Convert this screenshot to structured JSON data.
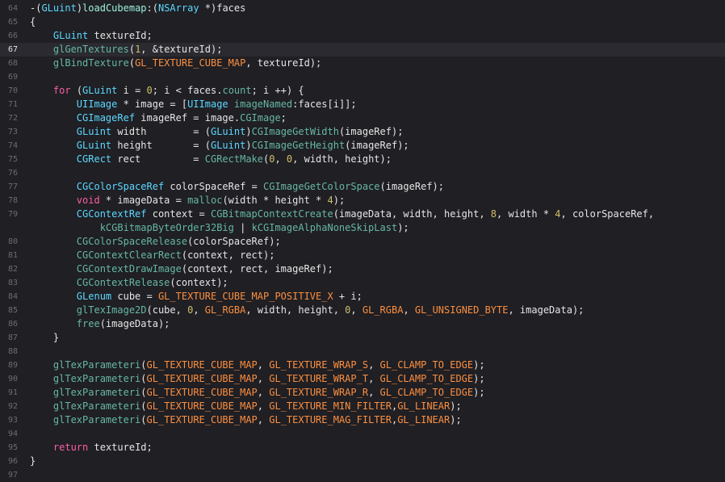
{
  "editor": {
    "current_line_number": "67",
    "lines": [
      {
        "num": "64",
        "current": false,
        "tokens": [
          {
            "t": "-(",
            "c": "plain"
          },
          {
            "t": "GLuint",
            "c": "type"
          },
          {
            "t": ")",
            "c": "plain"
          },
          {
            "t": "loadCubemap",
            "c": "proj"
          },
          {
            "t": ":(",
            "c": "plain"
          },
          {
            "t": "NSArray",
            "c": "type"
          },
          {
            "t": " *)faces",
            "c": "plain"
          }
        ]
      },
      {
        "num": "65",
        "current": false,
        "tokens": [
          {
            "t": "{",
            "c": "plain"
          }
        ]
      },
      {
        "num": "66",
        "current": false,
        "tokens": [
          {
            "t": "    ",
            "c": "plain"
          },
          {
            "t": "GLuint",
            "c": "type"
          },
          {
            "t": " textureId;",
            "c": "plain"
          }
        ]
      },
      {
        "num": "67",
        "current": true,
        "tokens": [
          {
            "t": "    ",
            "c": "plain"
          },
          {
            "t": "glGenTextures",
            "c": "method"
          },
          {
            "t": "(",
            "c": "plain"
          },
          {
            "t": "1",
            "c": "num"
          },
          {
            "t": ", &textureId);",
            "c": "plain"
          }
        ]
      },
      {
        "num": "68",
        "current": false,
        "tokens": [
          {
            "t": "    ",
            "c": "plain"
          },
          {
            "t": "glBindTexture",
            "c": "method"
          },
          {
            "t": "(",
            "c": "plain"
          },
          {
            "t": "GL_TEXTURE_CUBE_MAP",
            "c": "macro"
          },
          {
            "t": ", textureId);",
            "c": "plain"
          }
        ]
      },
      {
        "num": "69",
        "current": false,
        "tokens": [
          {
            "t": "",
            "c": "plain"
          }
        ]
      },
      {
        "num": "70",
        "current": false,
        "tokens": [
          {
            "t": "    ",
            "c": "plain"
          },
          {
            "t": "for",
            "c": "kw"
          },
          {
            "t": " (",
            "c": "plain"
          },
          {
            "t": "GLuint",
            "c": "type"
          },
          {
            "t": " i = ",
            "c": "plain"
          },
          {
            "t": "0",
            "c": "num"
          },
          {
            "t": "; i < faces.",
            "c": "plain"
          },
          {
            "t": "count",
            "c": "method"
          },
          {
            "t": "; i ++) {",
            "c": "plain"
          }
        ]
      },
      {
        "num": "71",
        "current": false,
        "tokens": [
          {
            "t": "        ",
            "c": "plain"
          },
          {
            "t": "UIImage",
            "c": "type"
          },
          {
            "t": " * image = [",
            "c": "plain"
          },
          {
            "t": "UIImage",
            "c": "type"
          },
          {
            "t": " ",
            "c": "plain"
          },
          {
            "t": "imageNamed",
            "c": "method"
          },
          {
            "t": ":faces[i]];",
            "c": "plain"
          }
        ]
      },
      {
        "num": "72",
        "current": false,
        "tokens": [
          {
            "t": "        ",
            "c": "plain"
          },
          {
            "t": "CGImageRef",
            "c": "type"
          },
          {
            "t": " imageRef = image.",
            "c": "plain"
          },
          {
            "t": "CGImage",
            "c": "method"
          },
          {
            "t": ";",
            "c": "plain"
          }
        ]
      },
      {
        "num": "73",
        "current": false,
        "tokens": [
          {
            "t": "        ",
            "c": "plain"
          },
          {
            "t": "GLuint",
            "c": "type"
          },
          {
            "t": " width        = (",
            "c": "plain"
          },
          {
            "t": "GLuint",
            "c": "type"
          },
          {
            "t": ")",
            "c": "plain"
          },
          {
            "t": "CGImageGetWidth",
            "c": "method"
          },
          {
            "t": "(imageRef);",
            "c": "plain"
          }
        ]
      },
      {
        "num": "74",
        "current": false,
        "tokens": [
          {
            "t": "        ",
            "c": "plain"
          },
          {
            "t": "GLuint",
            "c": "type"
          },
          {
            "t": " height       = (",
            "c": "plain"
          },
          {
            "t": "GLuint",
            "c": "type"
          },
          {
            "t": ")",
            "c": "plain"
          },
          {
            "t": "CGImageGetHeight",
            "c": "method"
          },
          {
            "t": "(imageRef);",
            "c": "plain"
          }
        ]
      },
      {
        "num": "75",
        "current": false,
        "tokens": [
          {
            "t": "        ",
            "c": "plain"
          },
          {
            "t": "CGRect",
            "c": "type"
          },
          {
            "t": " rect         = ",
            "c": "plain"
          },
          {
            "t": "CGRectMake",
            "c": "method"
          },
          {
            "t": "(",
            "c": "plain"
          },
          {
            "t": "0",
            "c": "num"
          },
          {
            "t": ", ",
            "c": "plain"
          },
          {
            "t": "0",
            "c": "num"
          },
          {
            "t": ", width, height);",
            "c": "plain"
          }
        ]
      },
      {
        "num": "76",
        "current": false,
        "tokens": [
          {
            "t": "",
            "c": "plain"
          }
        ]
      },
      {
        "num": "77",
        "current": false,
        "tokens": [
          {
            "t": "        ",
            "c": "plain"
          },
          {
            "t": "CGColorSpaceRef",
            "c": "type"
          },
          {
            "t": " colorSpaceRef = ",
            "c": "plain"
          },
          {
            "t": "CGImageGetColorSpace",
            "c": "method"
          },
          {
            "t": "(imageRef);",
            "c": "plain"
          }
        ]
      },
      {
        "num": "78",
        "current": false,
        "tokens": [
          {
            "t": "        ",
            "c": "plain"
          },
          {
            "t": "void",
            "c": "kw"
          },
          {
            "t": " * imageData = ",
            "c": "plain"
          },
          {
            "t": "malloc",
            "c": "method"
          },
          {
            "t": "(width * height * ",
            "c": "plain"
          },
          {
            "t": "4",
            "c": "num"
          },
          {
            "t": ");",
            "c": "plain"
          }
        ]
      },
      {
        "num": "79",
        "current": false,
        "tokens": [
          {
            "t": "        ",
            "c": "plain"
          },
          {
            "t": "CGContextRef",
            "c": "type"
          },
          {
            "t": " context = ",
            "c": "plain"
          },
          {
            "t": "CGBitmapContextCreate",
            "c": "method"
          },
          {
            "t": "(imageData, width, height, ",
            "c": "plain"
          },
          {
            "t": "8",
            "c": "num"
          },
          {
            "t": ", width * ",
            "c": "plain"
          },
          {
            "t": "4",
            "c": "num"
          },
          {
            "t": ", colorSpaceRef,",
            "c": "plain"
          }
        ]
      },
      {
        "num": "",
        "current": false,
        "tokens": [
          {
            "t": "            ",
            "c": "plain"
          },
          {
            "t": "kCGBitmapByteOrder32Big",
            "c": "method"
          },
          {
            "t": " | ",
            "c": "plain"
          },
          {
            "t": "kCGImageAlphaNoneSkipLast",
            "c": "method"
          },
          {
            "t": ");",
            "c": "plain"
          }
        ]
      },
      {
        "num": "80",
        "current": false,
        "tokens": [
          {
            "t": "        ",
            "c": "plain"
          },
          {
            "t": "CGColorSpaceRelease",
            "c": "method"
          },
          {
            "t": "(colorSpaceRef);",
            "c": "plain"
          }
        ]
      },
      {
        "num": "81",
        "current": false,
        "tokens": [
          {
            "t": "        ",
            "c": "plain"
          },
          {
            "t": "CGContextClearRect",
            "c": "method"
          },
          {
            "t": "(context, rect);",
            "c": "plain"
          }
        ]
      },
      {
        "num": "82",
        "current": false,
        "tokens": [
          {
            "t": "        ",
            "c": "plain"
          },
          {
            "t": "CGContextDrawImage",
            "c": "method"
          },
          {
            "t": "(context, rect, imageRef);",
            "c": "plain"
          }
        ]
      },
      {
        "num": "83",
        "current": false,
        "tokens": [
          {
            "t": "        ",
            "c": "plain"
          },
          {
            "t": "CGContextRelease",
            "c": "method"
          },
          {
            "t": "(context);",
            "c": "plain"
          }
        ]
      },
      {
        "num": "84",
        "current": false,
        "tokens": [
          {
            "t": "        ",
            "c": "plain"
          },
          {
            "t": "GLenum",
            "c": "type"
          },
          {
            "t": " cube = ",
            "c": "plain"
          },
          {
            "t": "GL_TEXTURE_CUBE_MAP_POSITIVE_X",
            "c": "macro"
          },
          {
            "t": " + i;",
            "c": "plain"
          }
        ]
      },
      {
        "num": "85",
        "current": false,
        "tokens": [
          {
            "t": "        ",
            "c": "plain"
          },
          {
            "t": "glTexImage2D",
            "c": "method"
          },
          {
            "t": "(cube, ",
            "c": "plain"
          },
          {
            "t": "0",
            "c": "num"
          },
          {
            "t": ", ",
            "c": "plain"
          },
          {
            "t": "GL_RGBA",
            "c": "macro"
          },
          {
            "t": ", width, height, ",
            "c": "plain"
          },
          {
            "t": "0",
            "c": "num"
          },
          {
            "t": ", ",
            "c": "plain"
          },
          {
            "t": "GL_RGBA",
            "c": "macro"
          },
          {
            "t": ", ",
            "c": "plain"
          },
          {
            "t": "GL_UNSIGNED_BYTE",
            "c": "macro"
          },
          {
            "t": ", imageData);",
            "c": "plain"
          }
        ]
      },
      {
        "num": "86",
        "current": false,
        "tokens": [
          {
            "t": "        ",
            "c": "plain"
          },
          {
            "t": "free",
            "c": "method"
          },
          {
            "t": "(imageData);",
            "c": "plain"
          }
        ]
      },
      {
        "num": "87",
        "current": false,
        "tokens": [
          {
            "t": "    }",
            "c": "plain"
          }
        ]
      },
      {
        "num": "88",
        "current": false,
        "tokens": [
          {
            "t": "",
            "c": "plain"
          }
        ]
      },
      {
        "num": "89",
        "current": false,
        "tokens": [
          {
            "t": "    ",
            "c": "plain"
          },
          {
            "t": "glTexParameteri",
            "c": "method"
          },
          {
            "t": "(",
            "c": "plain"
          },
          {
            "t": "GL_TEXTURE_CUBE_MAP",
            "c": "macro"
          },
          {
            "t": ", ",
            "c": "plain"
          },
          {
            "t": "GL_TEXTURE_WRAP_S",
            "c": "macro"
          },
          {
            "t": ", ",
            "c": "plain"
          },
          {
            "t": "GL_CLAMP_TO_EDGE",
            "c": "macro"
          },
          {
            "t": ");",
            "c": "plain"
          }
        ]
      },
      {
        "num": "90",
        "current": false,
        "tokens": [
          {
            "t": "    ",
            "c": "plain"
          },
          {
            "t": "glTexParameteri",
            "c": "method"
          },
          {
            "t": "(",
            "c": "plain"
          },
          {
            "t": "GL_TEXTURE_CUBE_MAP",
            "c": "macro"
          },
          {
            "t": ", ",
            "c": "plain"
          },
          {
            "t": "GL_TEXTURE_WRAP_T",
            "c": "macro"
          },
          {
            "t": ", ",
            "c": "plain"
          },
          {
            "t": "GL_CLAMP_TO_EDGE",
            "c": "macro"
          },
          {
            "t": ");",
            "c": "plain"
          }
        ]
      },
      {
        "num": "91",
        "current": false,
        "tokens": [
          {
            "t": "    ",
            "c": "plain"
          },
          {
            "t": "glTexParameteri",
            "c": "method"
          },
          {
            "t": "(",
            "c": "plain"
          },
          {
            "t": "GL_TEXTURE_CUBE_MAP",
            "c": "macro"
          },
          {
            "t": ", ",
            "c": "plain"
          },
          {
            "t": "GL_TEXTURE_WRAP_R",
            "c": "macro"
          },
          {
            "t": ", ",
            "c": "plain"
          },
          {
            "t": "GL_CLAMP_TO_EDGE",
            "c": "macro"
          },
          {
            "t": ");",
            "c": "plain"
          }
        ]
      },
      {
        "num": "92",
        "current": false,
        "tokens": [
          {
            "t": "    ",
            "c": "plain"
          },
          {
            "t": "glTexParameteri",
            "c": "method"
          },
          {
            "t": "(",
            "c": "plain"
          },
          {
            "t": "GL_TEXTURE_CUBE_MAP",
            "c": "macro"
          },
          {
            "t": ", ",
            "c": "plain"
          },
          {
            "t": "GL_TEXTURE_MIN_FILTER",
            "c": "macro"
          },
          {
            "t": ",",
            "c": "plain"
          },
          {
            "t": "GL_LINEAR",
            "c": "macro"
          },
          {
            "t": ");",
            "c": "plain"
          }
        ]
      },
      {
        "num": "93",
        "current": false,
        "tokens": [
          {
            "t": "    ",
            "c": "plain"
          },
          {
            "t": "glTexParameteri",
            "c": "method"
          },
          {
            "t": "(",
            "c": "plain"
          },
          {
            "t": "GL_TEXTURE_CUBE_MAP",
            "c": "macro"
          },
          {
            "t": ", ",
            "c": "plain"
          },
          {
            "t": "GL_TEXTURE_MAG_FILTER",
            "c": "macro"
          },
          {
            "t": ",",
            "c": "plain"
          },
          {
            "t": "GL_LINEAR",
            "c": "macro"
          },
          {
            "t": ");",
            "c": "plain"
          }
        ]
      },
      {
        "num": "94",
        "current": false,
        "tokens": [
          {
            "t": "",
            "c": "plain"
          }
        ]
      },
      {
        "num": "95",
        "current": false,
        "tokens": [
          {
            "t": "    ",
            "c": "plain"
          },
          {
            "t": "return",
            "c": "kw"
          },
          {
            "t": " textureId;",
            "c": "plain"
          }
        ]
      },
      {
        "num": "96",
        "current": false,
        "tokens": [
          {
            "t": "}",
            "c": "plain"
          }
        ]
      },
      {
        "num": "97",
        "current": false,
        "tokens": [
          {
            "t": "",
            "c": "plain"
          }
        ]
      }
    ]
  },
  "colors": {
    "background": "#1f1f24",
    "current_line": "#2a2a30",
    "plain": "#e6e6e6",
    "keyword": "#fc5fa3",
    "type": "#5dd8ff",
    "project": "#9ef1dd",
    "number": "#d0bf69",
    "macro": "#fd8f3f",
    "method": "#67b7a4",
    "gutter": "#6c6c75"
  }
}
